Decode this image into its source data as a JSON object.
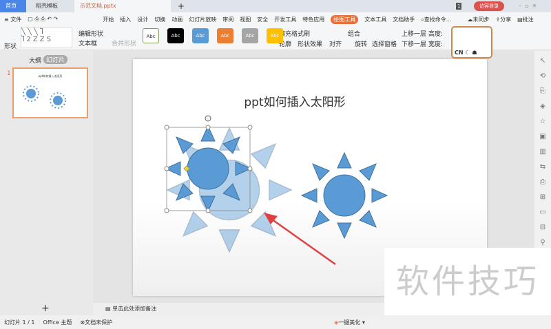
{
  "tabs": [
    "首页",
    "稻壳模板",
    "示范文档.pptx"
  ],
  "window": {
    "badge": "1",
    "login": "访客登录"
  },
  "menu": {
    "file": "文件",
    "items": [
      "开始",
      "插入",
      "设计",
      "切换",
      "动画",
      "幻灯片放映",
      "审阅",
      "视图",
      "安全",
      "开发工具",
      "特色应用",
      "绘图工具",
      "文本工具",
      "文档助手"
    ],
    "search": "查找命令...",
    "sync": "未同步",
    "share": "分享",
    "comment": "批注"
  },
  "ribbon": {
    "shape": "形状",
    "edit_shape": "编辑形状",
    "textbox": "文本框",
    "merge": "合并形状",
    "style_label": "Abc",
    "fill": "填充",
    "format_painter": "格式刷",
    "outline": "轮廓",
    "effects": "形状效果",
    "align": "对齐",
    "group": "组合",
    "rotate": "旋转",
    "selection_pane": "选择窗格",
    "bring_forward": "上移一层",
    "send_backward": "下移一层",
    "height": "高度:",
    "width": "宽度:",
    "ime": "CN"
  },
  "styles_colors": [
    "#ffffff",
    "#000000",
    "#5b9bd5",
    "#ed7d31",
    "#a5a5a5",
    "#ffc000"
  ],
  "left": {
    "outline_tab": "大纲",
    "slides_tab": "幻灯片",
    "slide_num": "1",
    "thumb_title": "ppt如何插入太阳形",
    "add": "+"
  },
  "slide": {
    "title": "ppt如何插入太阳形"
  },
  "notes": "单击此处添加备注",
  "status": {
    "slide": "幻灯片 1 / 1",
    "theme": "Office 主题",
    "protect": "文档未保护",
    "beautify": "一键美化"
  },
  "watermark": "软件技巧"
}
